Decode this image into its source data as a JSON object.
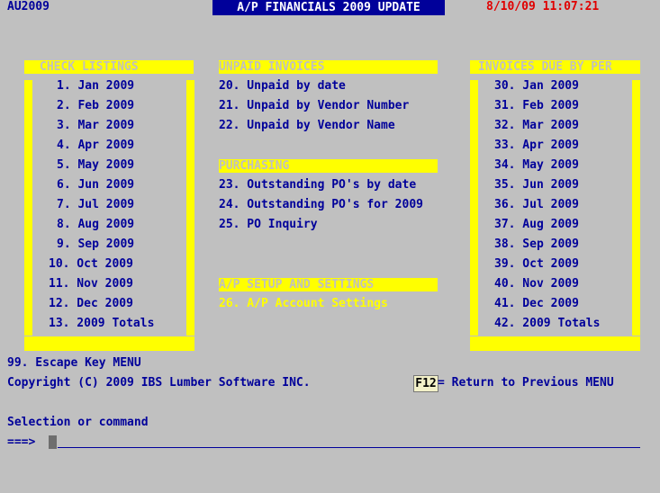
{
  "header": {
    "program_code": "AU2009",
    "title": "A/P FINANCIALS 2009 UPDATE",
    "datetime": "8/10/09 11:07:21"
  },
  "check_listings": {
    "header": "CHECK LISTINGS",
    "items": [
      "1. Jan 2009",
      "2. Feb 2009",
      "3. Mar 2009",
      "4. Apr 2009",
      "5. May 2009",
      "6. Jun 2009",
      "7. Jul 2009",
      "8. Aug 2009",
      "9. Sep 2009",
      "10. Oct 2009",
      "11. Nov 2009",
      "12. Dec 2009",
      "13. 2009 Totals"
    ]
  },
  "unpaid_invoices": {
    "header": "UNPAID INVOICES",
    "items": [
      "20. Unpaid by date",
      "21. Unpaid by Vendor Number",
      "22. Unpaid by Vendor Name"
    ]
  },
  "purchasing": {
    "header": "PURCHASING",
    "items": [
      "23. Outstanding PO's by date",
      "24. Outstanding PO's for 2009",
      "25. PO Inquiry"
    ]
  },
  "ap_setup": {
    "header": "A/P SETUP AND SETTINGS",
    "items": [
      "26. A/P Account Settings"
    ]
  },
  "invoices_due": {
    "header": "INVOICES DUE BY PER",
    "items": [
      "30. Jan 2009",
      "31. Feb 2009",
      "32. Mar 2009",
      "33. Apr 2009",
      "34. May 2009",
      "35. Jun 2009",
      "36. Jul 2009",
      "37. Aug 2009",
      "38. Sep 2009",
      "39. Oct 2009",
      "40. Nov 2009",
      "41. Dec 2009",
      "42. 2009 Totals"
    ]
  },
  "footer": {
    "escape": "99. Escape Key MENU",
    "copyright": "Copyright (C) 2009 IBS Lumber Software INC.",
    "f12_key": "F12",
    "f12_text": "= Return to Previous MENU",
    "prompt_label": "Selection or command",
    "prompt_arrow": "===>",
    "command_value": ""
  }
}
